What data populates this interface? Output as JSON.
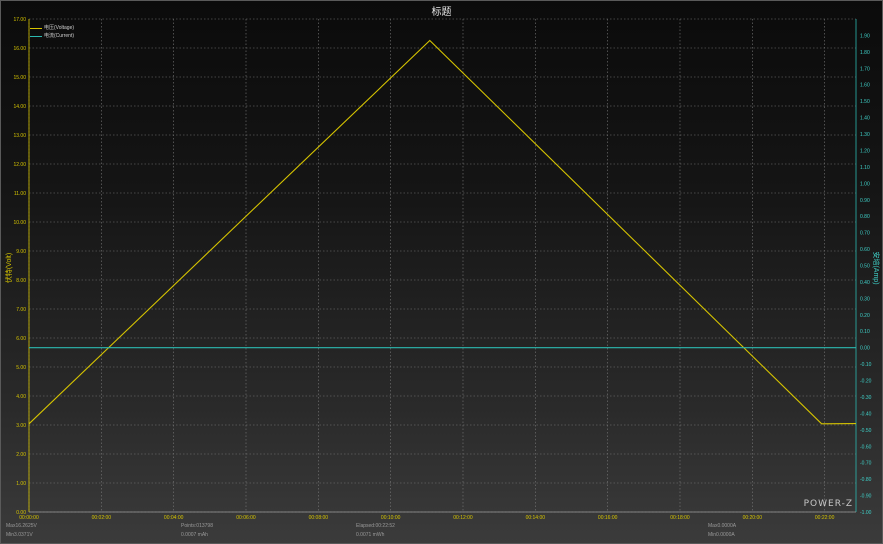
{
  "title": "标题",
  "legend": [
    {
      "label": "电压(Voltage)",
      "color": "#d6c400"
    },
    {
      "label": "电流(Current)",
      "color": "#2bb8b0"
    }
  ],
  "y_left_label": "伏特(Volt)",
  "y_right_label": "安培(Amp)",
  "brand": "POWER-Z",
  "stats": {
    "max_v": "Max16.2625V",
    "min_v": "Min3.0371V",
    "points": "Points:013798",
    "mah": "0.0007 mAh",
    "elapsed": "Elapsed:00:22:52",
    "mwh": "0.0071 mWh",
    "max_a": "Max0.0000A",
    "min_a": "Min0.0000A"
  },
  "chart_data": {
    "type": "line",
    "title": "标题",
    "xlabel": "",
    "ylabel": "伏特(Volt)",
    "ylabel_right": "安培(Amp)",
    "x_ticks": [
      "00:00:00",
      "00:02:00",
      "00:04:00",
      "00:06:00",
      "00:08:00",
      "00:10:00",
      "00:12:00",
      "00:14:00",
      "00:16:00",
      "00:18:00",
      "00:20:00",
      "00:22:00"
    ],
    "y_left_ticks": [
      "0.00",
      "1.00",
      "2.00",
      "3.00",
      "4.00",
      "5.00",
      "6.00",
      "7.00",
      "8.00",
      "9.00",
      "10.00",
      "11.00",
      "12.00",
      "13.00",
      "14.00",
      "15.00",
      "16.00",
      "17.00"
    ],
    "y_right_ticks": [
      "1.90",
      "1.80",
      "1.70",
      "1.60",
      "1.50",
      "1.40",
      "1.30",
      "1.20",
      "1.10",
      "1.00",
      "0.90",
      "0.80",
      "0.70",
      "0.60",
      "0.50",
      "0.40",
      "0.30",
      "0.20",
      "0.10",
      "0.00",
      "-0.10",
      "-0.20",
      "-0.30",
      "-0.40",
      "-0.50",
      "-0.60",
      "-0.70",
      "-0.80",
      "-0.90",
      "-1.00"
    ],
    "xlim_seconds": [
      0,
      1372
    ],
    "ylim_left": [
      0,
      17
    ],
    "ylim_right": [
      -1.0,
      2.0
    ],
    "grid": true,
    "series": [
      {
        "name": "电压(Voltage)",
        "axis": "left",
        "color": "#d6c400",
        "x": [
          "00:00:00",
          "00:11:05",
          "00:21:55",
          "00:22:52"
        ],
        "y": [
          3.04,
          16.26,
          3.04,
          3.05
        ]
      },
      {
        "name": "电流(Current)",
        "axis": "right",
        "color": "#2bb8b0",
        "x": [
          "00:00:00",
          "00:22:52"
        ],
        "y": [
          0.0,
          0.0
        ]
      }
    ]
  }
}
